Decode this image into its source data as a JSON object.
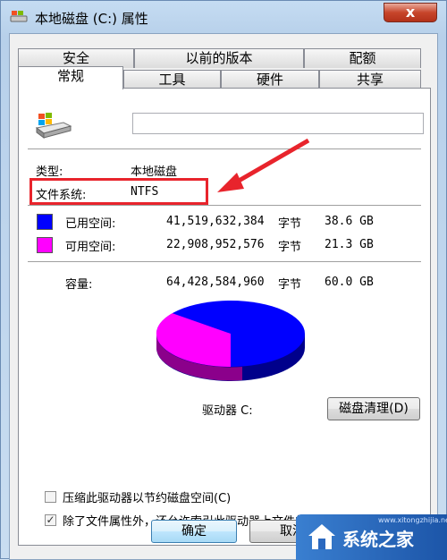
{
  "window": {
    "title": "本地磁盘 (C:) 属性",
    "close_glyph": "x"
  },
  "tabs_row1": [
    "安全",
    "以前的版本",
    "配额"
  ],
  "tabs_row2": [
    "常规",
    "工具",
    "硬件",
    "共享"
  ],
  "active_tab": "常规",
  "general": {
    "drive_name_value": "",
    "type_label": "类型:",
    "type_value": "本地磁盘",
    "fs_label": "文件系统:",
    "fs_value": "NTFS",
    "used_label": "已用空间:",
    "used_bytes": "41,519,632,384",
    "used_unit": "字节",
    "used_gb": "38.6 GB",
    "free_label": "可用空间:",
    "free_bytes": "22,908,952,576",
    "free_unit": "字节",
    "free_gb": "21.3 GB",
    "capacity_label": "容量:",
    "capacity_bytes": "64,428,584,960",
    "capacity_unit": "字节",
    "capacity_gb": "60.0 GB",
    "drive_caption": "驱动器 C:",
    "cleanup_button": "磁盘清理(D)",
    "compress_label": "压缩此驱动器以节约磁盘空间(C)",
    "compress_checked": false,
    "index_label": "除了文件属性外，还允许索引此驱动器上文件的内容(I)",
    "index_checked": true,
    "check_glyph": "✓"
  },
  "buttons": {
    "ok": "确定",
    "cancel": "取消"
  },
  "colors": {
    "used": "#0000ff",
    "free": "#ff00ff",
    "highlight": "#e8242c"
  },
  "usage": {
    "used_fraction": 0.644,
    "free_fraction": 0.356
  },
  "watermark": {
    "text": "系统之家",
    "url": "www.xitongzhijia.net"
  }
}
